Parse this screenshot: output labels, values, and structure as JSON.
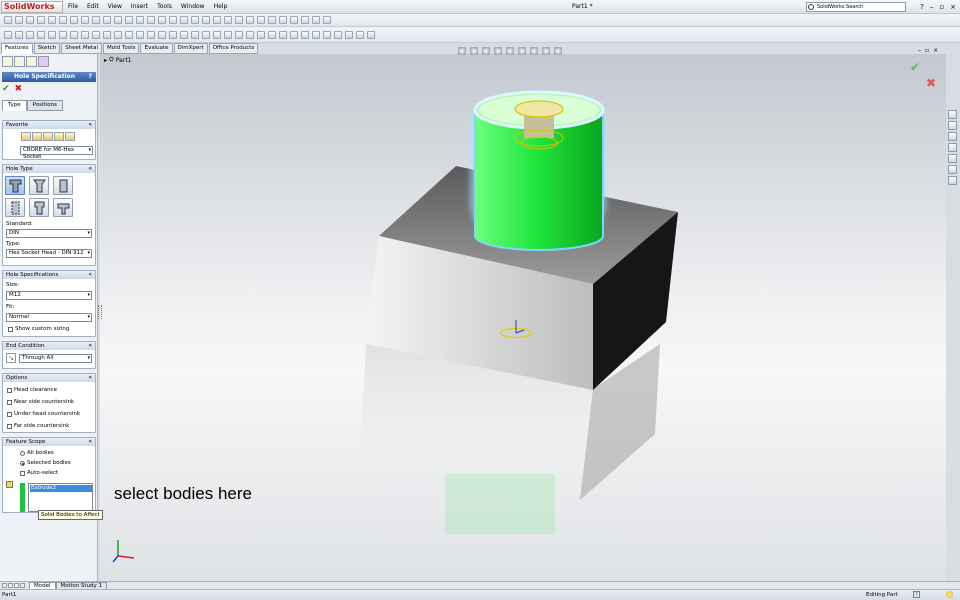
{
  "app": {
    "logo": "SolidWorks",
    "document_title": "Part1 *",
    "search_placeholder": "SolidWorks Search",
    "menu": [
      "File",
      "Edit",
      "View",
      "Insert",
      "Tools",
      "Window",
      "Help"
    ]
  },
  "command_tabs": [
    {
      "label": "Features",
      "active": true
    },
    {
      "label": "Sketch",
      "active": false
    },
    {
      "label": "Sheet Metal",
      "active": false
    },
    {
      "label": "Mold Tools",
      "active": false
    },
    {
      "label": "Evaluate",
      "active": false
    },
    {
      "label": "DimXpert",
      "active": false
    },
    {
      "label": "Office Products",
      "active": false
    }
  ],
  "property_manager": {
    "title": "Hole Specification",
    "help": "?",
    "tabs": {
      "type": "Type",
      "positions": "Positions"
    },
    "favorite": {
      "header": "Favorite",
      "selected": "CBORE for M6-Hex Socket"
    },
    "hole_type": {
      "header": "Hole Type",
      "standard_label": "Standard:",
      "standard_value": "DIN",
      "type_label": "Type:",
      "type_value": "Hex Socket Head - DIN 912"
    },
    "hole_specs": {
      "header": "Hole Specifications",
      "size_label": "Size:",
      "size_value": "M12",
      "fit_label": "Fit:",
      "fit_value": "Normal",
      "custom_sizing": "Show custom sizing"
    },
    "end_condition": {
      "header": "End Condition",
      "value": "Through All"
    },
    "options": {
      "header": "Options",
      "items": [
        "Head clearance",
        "Near side countersink",
        "Under head countersink",
        "Far side countersink"
      ]
    },
    "feature_scope": {
      "header": "Feature Scope",
      "all_bodies": "All bodies",
      "selected_bodies": "Selected bodies",
      "selected_option": "selected_bodies",
      "auto_select": "Auto-select",
      "bodies": [
        "Extrude2"
      ],
      "tooltip": "Solid Bodies to Affect"
    }
  },
  "viewport": {
    "tree_root": "Part1",
    "annotation": "select bodies here",
    "accent_green": "#1ee33a"
  },
  "bottom_tabs": [
    {
      "label": "Model",
      "active": true
    },
    {
      "label": "Motion Study 1",
      "active": false
    }
  ],
  "status": {
    "left": "Part1",
    "mode": "Editing Part",
    "help_icon": "?"
  }
}
